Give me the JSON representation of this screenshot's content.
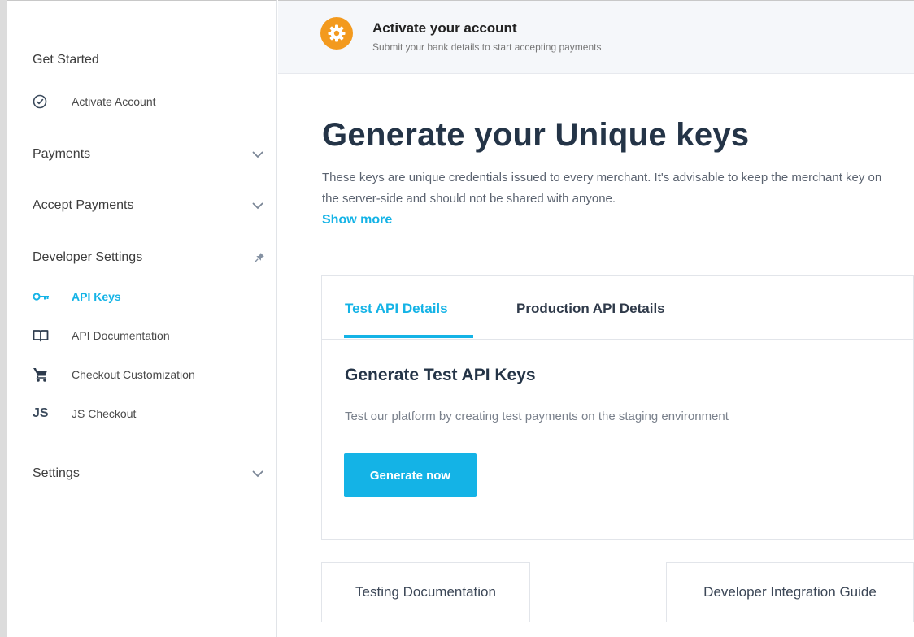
{
  "banner": {
    "icon": "gear-icon",
    "icon_color": "#f39a1e",
    "title": "Activate your account",
    "subtitle": "Submit your bank details to start accepting payments"
  },
  "sidebar": {
    "get_started": {
      "label": "Get Started",
      "items": [
        {
          "label": "Activate Account",
          "icon": "check-circle-icon"
        }
      ]
    },
    "payments": {
      "label": "Payments",
      "icon": "chevron-down-icon"
    },
    "accept_payments": {
      "label": "Accept Payments",
      "icon": "chevron-down-icon"
    },
    "developer_settings": {
      "label": "Developer Settings",
      "icon": "pin-icon",
      "items": [
        {
          "label": "API Keys",
          "icon": "key-icon",
          "active": true
        },
        {
          "label": "API Documentation",
          "icon": "book-icon"
        },
        {
          "label": "Checkout Customization",
          "icon": "cart-icon"
        },
        {
          "label": "JS Checkout",
          "icon": "js-icon",
          "icon_text": "JS"
        }
      ]
    },
    "settings": {
      "label": "Settings",
      "icon": "chevron-down-icon"
    }
  },
  "main": {
    "title": "Generate your Unique keys",
    "description": "These keys are unique credentials issued to every merchant. It's advisable to keep the merchant key on the server-side and should not be shared with anyone.",
    "show_more": "Show more",
    "card": {
      "tabs": [
        {
          "label": "Test API Details",
          "active": true
        },
        {
          "label": "Production API Details",
          "active": false
        }
      ],
      "title": "Generate Test API Keys",
      "description": "Test our platform by creating test payments on the staging environment",
      "button": "Generate now"
    },
    "links": [
      {
        "label": "Testing Documentation"
      },
      {
        "label": "Developer Integration Guide"
      }
    ]
  },
  "colors": {
    "accent": "#14b3e6",
    "heading": "#243447",
    "banner_bg": "#f5f7fa"
  }
}
